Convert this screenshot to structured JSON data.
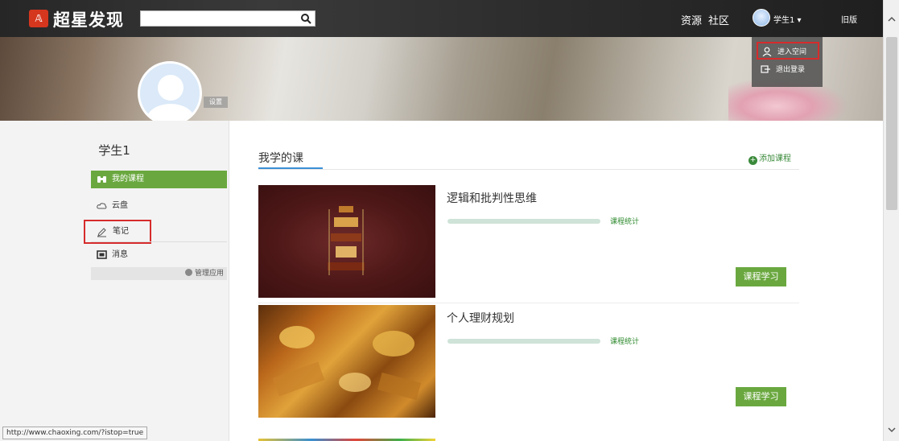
{
  "header": {
    "brand": "超星发现",
    "search": {
      "value": "",
      "placeholder": ""
    },
    "nav": {
      "resources": "资源",
      "community": "社区",
      "username": "学生1 ▾",
      "old_version": "旧版"
    },
    "user_menu": {
      "enter_space": "进入空间",
      "logout": "退出登录"
    }
  },
  "profile": {
    "settings_label": "设置",
    "name": "学生1"
  },
  "sidebar": {
    "items": [
      {
        "label": "我的课程",
        "icon": "binoculars-icon"
      },
      {
        "label": "云盘",
        "icon": "cloud-icon"
      },
      {
        "label": "笔记",
        "icon": "pencil-icon"
      },
      {
        "label": "消息",
        "icon": "message-icon"
      }
    ],
    "manage_apps": "管理应用"
  },
  "main": {
    "section_title": "我学的课",
    "add_course": "添加课程",
    "courses": [
      {
        "title": "逻辑和批判性思维",
        "progress_label": "0.0%",
        "progress": 0.0,
        "stats_label": "课程统计",
        "study_label": "课程学习"
      },
      {
        "title": "个人理财规划",
        "progress_label": "0.0%",
        "progress": 0.0,
        "stats_label": "课程统计",
        "study_label": "课程学习"
      }
    ]
  },
  "status_bar": {
    "url": "http://www.chaoxing.com/?istop=true"
  },
  "colors": {
    "accent_green": "#6aa83f",
    "highlight_red": "#d62b2b",
    "tab_underline": "#3b8fd6"
  }
}
